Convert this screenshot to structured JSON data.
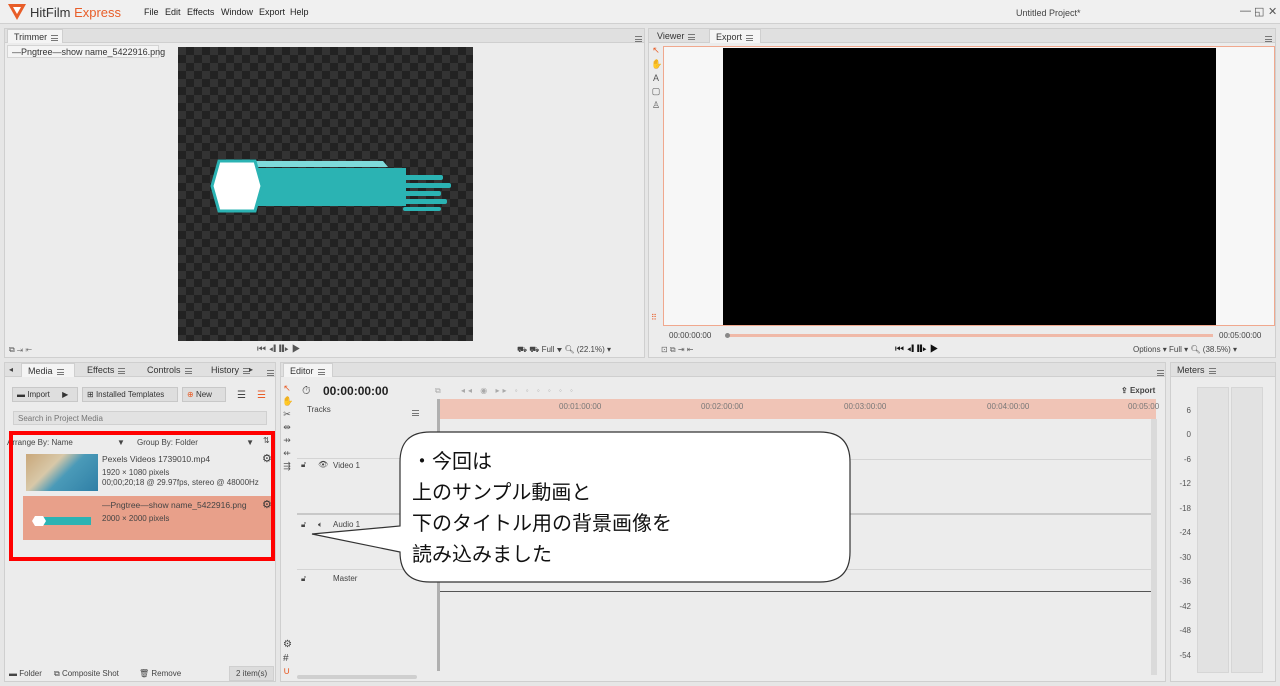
{
  "app": {
    "name_part1": "HitFilm",
    "name_part2": "Express",
    "project_title": "Untitled Project*"
  },
  "menu": [
    "File",
    "Edit",
    "Effects",
    "Window",
    "Export",
    "Help"
  ],
  "window_controls": {
    "minimize": "—",
    "restore": "◱",
    "close": "✕"
  },
  "trimmer": {
    "tab": "Trimmer",
    "file_tab": "—Pngtree—show name_5422916.png",
    "zoom_mode": "Full",
    "zoom_value": "(22.1%)"
  },
  "viewer": {
    "tabs": [
      "Viewer",
      "Export"
    ],
    "timecode_start": "00:00:00:00",
    "timecode_end": "00:05:00:00",
    "options": "Options",
    "zoom_mode": "Full",
    "zoom_value": "(38.5%)",
    "tools": [
      "↖",
      "✋",
      "A",
      "▢",
      "♙"
    ]
  },
  "media": {
    "panel_tabs": [
      "Media",
      "Effects",
      "Controls",
      "History"
    ],
    "import_label": "Import",
    "templates_label": "Installed Templates",
    "new_label": "New",
    "search_placeholder": "Search in Project Media",
    "arrange_label": "Arrange By: Name",
    "group_label": "Group By: Folder",
    "items": [
      {
        "name": "Pexels Videos 1739010.mp4",
        "dims": "1920 × 1080 pixels",
        "info": "00;00;20;18 @ 29.97fps, stereo @ 48000Hz"
      },
      {
        "name": "—Pngtree—show name_5422916.png",
        "dims": "2000 × 2000 pixels",
        "info": ""
      }
    ],
    "footer_folder": "Folder",
    "footer_composite": "Composite Shot",
    "footer_remove": "Remove",
    "footer_count": "2 item(s)"
  },
  "editor": {
    "tab": "Editor",
    "timecode": "00:00:00:00",
    "export_label": "Export",
    "tracks_label": "Tracks",
    "track_video": "Video 1",
    "track_audio": "Audio 1",
    "track_master": "Master",
    "ruler": [
      "00:01:00:00",
      "00:02:00:00",
      "00:03:00:00",
      "00:04:00:00",
      "00:05:00"
    ]
  },
  "meters": {
    "tab": "Meters",
    "scale": [
      "6",
      "0",
      "-6",
      "-12",
      "-18",
      "-24",
      "-30",
      "-36",
      "-42",
      "-48",
      "-54"
    ]
  },
  "callout": {
    "lines": [
      "・今回は",
      "上のサンプル動画と",
      "下のタイトル用の背景画像を",
      "読み込みました"
    ]
  },
  "colors": {
    "accent": "#e85d28",
    "selection": "#e8a08a",
    "highlight_box": "#ff0000",
    "teal": "#2bb3b3"
  }
}
